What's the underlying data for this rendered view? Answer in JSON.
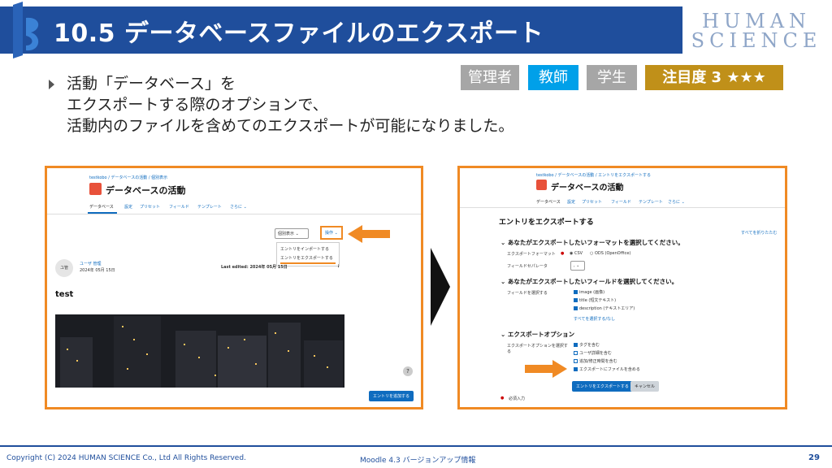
{
  "header": {
    "title": "10.5 データベースファイルのエクスポート",
    "brand": [
      "HUMAN",
      "SCIENCE"
    ]
  },
  "bullet": {
    "lines": [
      "活動「データベース」を",
      "エクスポートする際のオプションで、",
      "活動内のファイルを含めてのエクスポートが可能になりました。"
    ]
  },
  "tags": {
    "admin": "管理者",
    "teacher": "教師",
    "student": "学生",
    "attention": "注目度 3 ★★★"
  },
  "colors": {
    "title_band": "#1f4e9c",
    "accent_orange": "#f08a24",
    "teacher_tag": "#00a0e9",
    "inactive_tag": "#a6a6a6",
    "attention_tag": "#c09019",
    "moodle_blue": "#0f6cbf"
  },
  "left_panel": {
    "breadcrumb": "testkobo / データベースの活動 / 個別表示",
    "title": "データベースの活動",
    "nav": [
      "データベース",
      "設定",
      "プリセット",
      "フィールド",
      "テンプレート",
      "さらに ⌄"
    ],
    "view_select": "個別表示",
    "ops_button": "操作 ⌄",
    "menu": [
      "エントリをインポートする",
      "エントリをエクスポートする"
    ],
    "avatar_initials": "ユ管",
    "user_name": "ユーザ 管理",
    "user_date": "2024年 05月 15日",
    "last_edited": "Last edited: 2024年 05月 15日",
    "entry_title": "test",
    "help_symbol": "?",
    "add_entry_button": "エントリを追加する"
  },
  "right_panel": {
    "breadcrumb": "testkobo / データベースの活動 / エントリをエクスポートする",
    "title": "データベースの活動",
    "nav": [
      "データベース",
      "設定",
      "プリセット",
      "フィールド",
      "テンプレート",
      "さらに ⌄"
    ],
    "page_heading": "エントリをエクスポートする",
    "collapse_all": "すべてを折りたたむ",
    "section1": "あなたがエクスポートしたいフォーマットを選択してください。",
    "export_format_label": "エクスポートフォーマット",
    "format_csv": "CSV",
    "format_ods": "ODS (OpenOffice)",
    "separator_label": "フィールドセパレータ",
    "separator_value": ",",
    "section2": "あなたがエクスポートしたいフィールドを選択してください。",
    "fields_label": "フィールドを選択する",
    "fields": [
      "image (画像)",
      "title (短文テキスト)",
      "description (テキストエリア)"
    ],
    "select_all": "すべてを選択する/なし",
    "section3": "エクスポートオプション",
    "options_label": "エクスポートオプションを選択する",
    "options": [
      {
        "label": "タグを含む",
        "checked": true
      },
      {
        "label": "ユーザ詳細を含む",
        "checked": false
      },
      {
        "label": "追加/修正時間を含む",
        "checked": false
      },
      {
        "label": "エクスポートにファイルを含める",
        "checked": true
      }
    ],
    "export_button": "エントリをエクスポートする",
    "cancel_button": "キャンセル",
    "required": "必須入力"
  },
  "footer": {
    "copyright": "Copyright (C) 2024 HUMAN SCIENCE Co., Ltd All Rights Reserved.",
    "subtitle": "Moodle 4.3 バージョンアップ情報",
    "page": "29"
  }
}
